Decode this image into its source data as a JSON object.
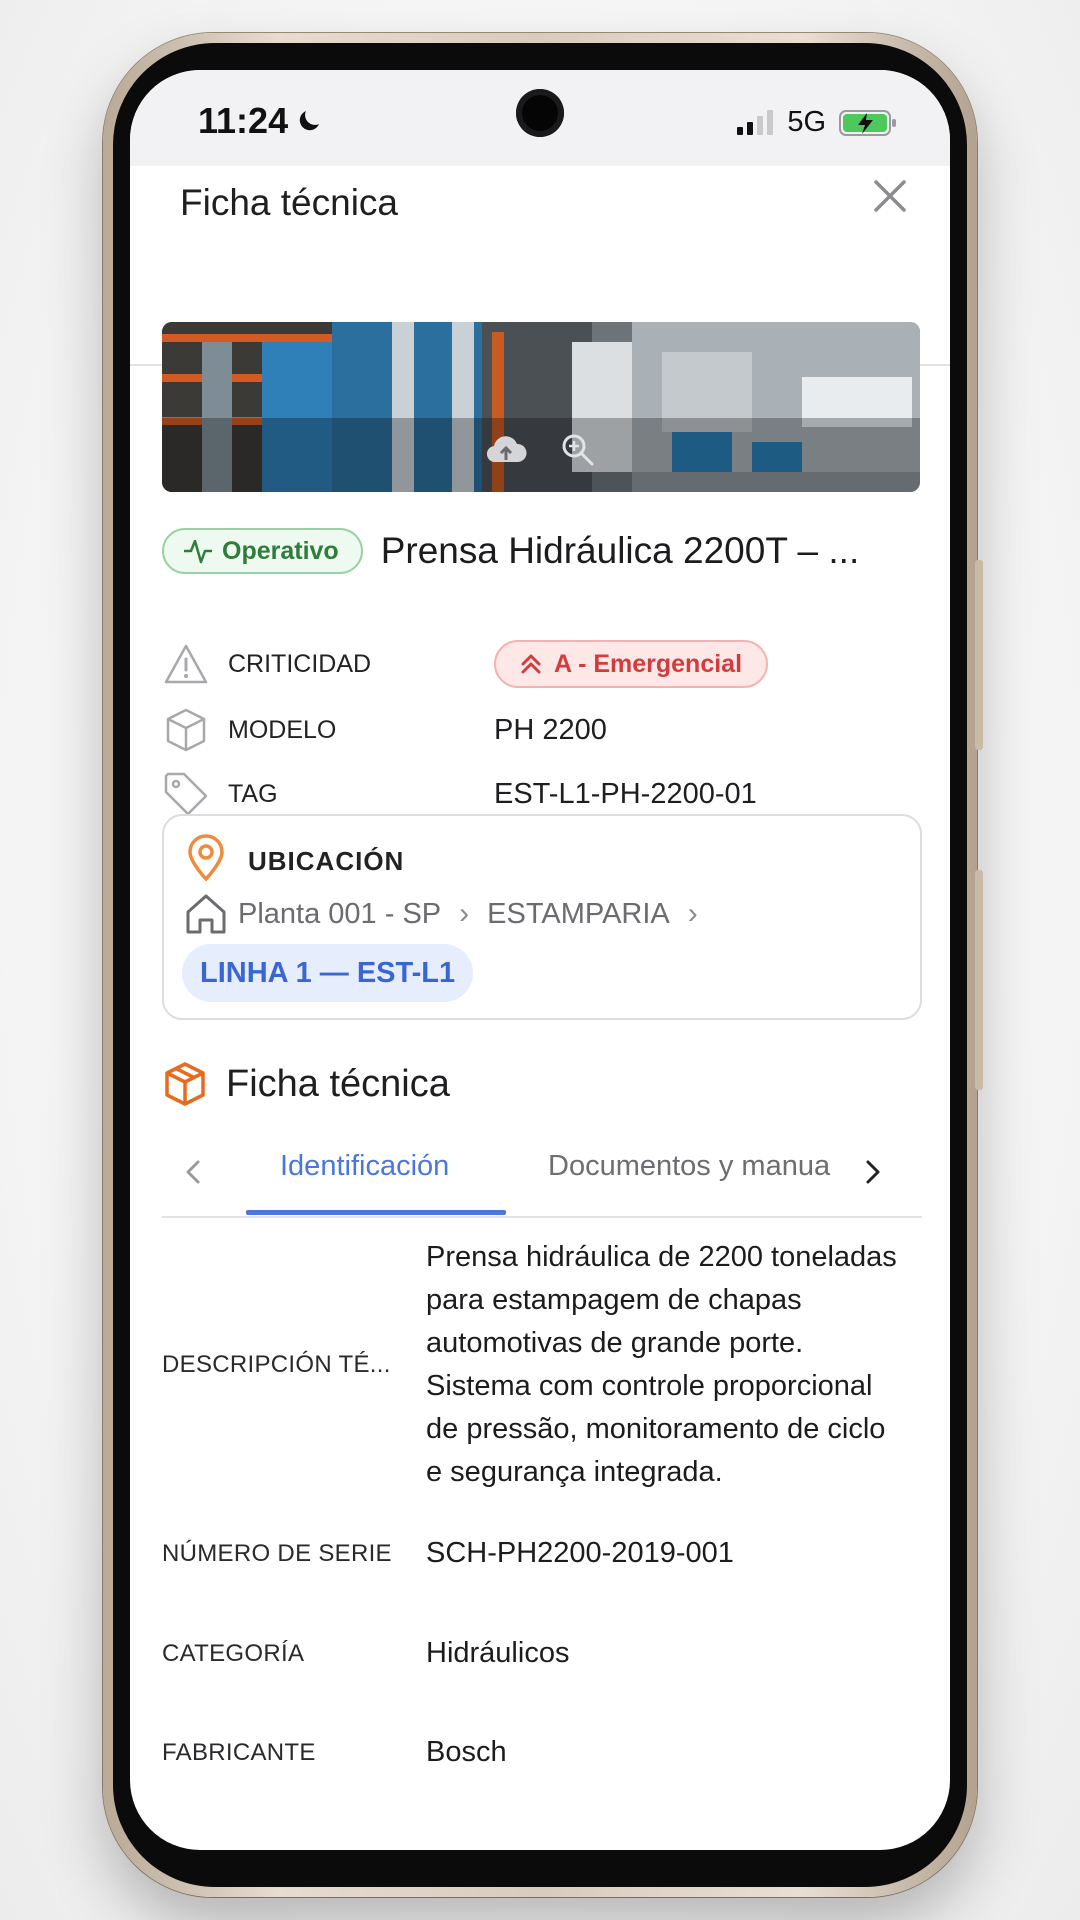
{
  "status_bar": {
    "time": "11:24",
    "network": "5G"
  },
  "sheet": {
    "title": "Ficha técnica"
  },
  "asset": {
    "status": "Operativo",
    "name": "Prensa Hidráulica 2200T – ...",
    "attributes": [
      {
        "label": "CRITICIDAD",
        "value": "A - Emergencial"
      },
      {
        "label": "MODELO",
        "value": "PH 2200"
      },
      {
        "label": "TAG",
        "value": "EST-L1-PH-2200-01"
      }
    ]
  },
  "location": {
    "title": "UBICACIÓN",
    "breadcrumb": [
      "Planta 001 - SP",
      "ESTAMPARIA"
    ],
    "current": "LINHA 1 — EST-L1"
  },
  "specs": {
    "title": "Ficha técnica",
    "tabs": [
      "Identificación",
      "Documentos y manua"
    ],
    "active_tab": "Identificación",
    "fields": [
      {
        "label": "DESCRIPCIÓN TÉ...",
        "value": "Prensa hidráulica de 2200 toneladas para estampagem de chapas automotivas de grande porte. Sistema com controle proporcional de pressão, monitoramento de ciclo e segurança integrada."
      },
      {
        "label": "NÚMERO DE SERIE",
        "value": "SCH-PH2200-2019-001"
      },
      {
        "label": "CATEGORÍA",
        "value": "Hidráulicos"
      },
      {
        "label": "FABRICANTE",
        "value": "Bosch"
      }
    ]
  },
  "colors": {
    "accent": "#4a76de",
    "operativo": "#2e7d3a",
    "emergencial": "#d23c3c",
    "location_icon": "#f08a3c",
    "section_icon": "#e86a1f"
  }
}
